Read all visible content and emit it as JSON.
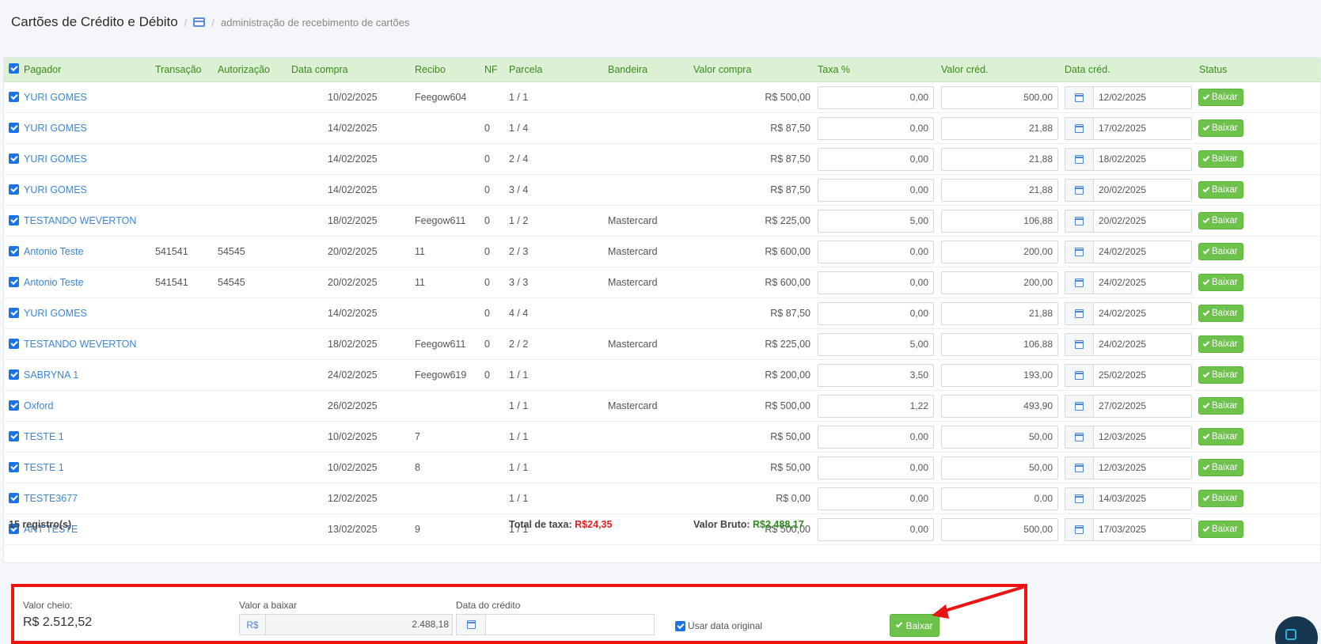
{
  "header": {
    "title": "Cartões de Crédito e Débito",
    "crumb": "administração de recebimento de cartões"
  },
  "table": {
    "columns": {
      "pagador": "Pagador",
      "transacao": "Transação",
      "autorizacao": "Autorização",
      "data_compra": "Data compra",
      "recibo": "Recibo",
      "nf": "NF",
      "parcela": "Parcela",
      "bandeira": "Bandeira",
      "valor_compra": "Valor compra",
      "taxa": "Taxa %",
      "valor_cred": "Valor créd.",
      "data_cred": "Data créd.",
      "status": "Status"
    },
    "rows": [
      {
        "pagador": "YURI GOMES",
        "transacao": "",
        "autorizacao": "",
        "data_compra": "10/02/2025",
        "recibo": "Feegow604",
        "nf": "",
        "parcela": "1 / 1",
        "bandeira": "",
        "valor_compra": "R$ 500,00",
        "taxa": "0,00",
        "valor_cred": "500,00",
        "data_cred": "12/02/2025",
        "status": "Baixar"
      },
      {
        "pagador": "YURI GOMES",
        "transacao": "",
        "autorizacao": "",
        "data_compra": "14/02/2025",
        "recibo": "",
        "nf": "0",
        "parcela": "1 / 4",
        "bandeira": "",
        "valor_compra": "R$ 87,50",
        "taxa": "0,00",
        "valor_cred": "21,88",
        "data_cred": "17/02/2025",
        "status": "Baixar"
      },
      {
        "pagador": "YURI GOMES",
        "transacao": "",
        "autorizacao": "",
        "data_compra": "14/02/2025",
        "recibo": "",
        "nf": "0",
        "parcela": "2 / 4",
        "bandeira": "",
        "valor_compra": "R$ 87,50",
        "taxa": "0,00",
        "valor_cred": "21,88",
        "data_cred": "18/02/2025",
        "status": "Baixar"
      },
      {
        "pagador": "YURI GOMES",
        "transacao": "",
        "autorizacao": "",
        "data_compra": "14/02/2025",
        "recibo": "",
        "nf": "0",
        "parcela": "3 / 4",
        "bandeira": "",
        "valor_compra": "R$ 87,50",
        "taxa": "0,00",
        "valor_cred": "21,88",
        "data_cred": "20/02/2025",
        "status": "Baixar"
      },
      {
        "pagador": "TESTANDO WEVERTON",
        "transacao": "",
        "autorizacao": "",
        "data_compra": "18/02/2025",
        "recibo": "Feegow611",
        "nf": "0",
        "parcela": "1 / 2",
        "bandeira": "Mastercard",
        "valor_compra": "R$ 225,00",
        "taxa": "5,00",
        "valor_cred": "106,88",
        "data_cred": "20/02/2025",
        "status": "Baixar"
      },
      {
        "pagador": "Antonio Teste",
        "transacao": "541541",
        "autorizacao": "54545",
        "data_compra": "20/02/2025",
        "recibo": "11",
        "nf": "0",
        "parcela": "2 / 3",
        "bandeira": "Mastercard",
        "valor_compra": "R$ 600,00",
        "taxa": "0,00",
        "valor_cred": "200,00",
        "data_cred": "24/02/2025",
        "status": "Baixar"
      },
      {
        "pagador": "Antonio Teste",
        "transacao": "541541",
        "autorizacao": "54545",
        "data_compra": "20/02/2025",
        "recibo": "11",
        "nf": "0",
        "parcela": "3 / 3",
        "bandeira": "Mastercard",
        "valor_compra": "R$ 600,00",
        "taxa": "0,00",
        "valor_cred": "200,00",
        "data_cred": "24/02/2025",
        "status": "Baixar"
      },
      {
        "pagador": "YURI GOMES",
        "transacao": "",
        "autorizacao": "",
        "data_compra": "14/02/2025",
        "recibo": "",
        "nf": "0",
        "parcela": "4 / 4",
        "bandeira": "",
        "valor_compra": "R$ 87,50",
        "taxa": "0,00",
        "valor_cred": "21,88",
        "data_cred": "24/02/2025",
        "status": "Baixar"
      },
      {
        "pagador": "TESTANDO WEVERTON",
        "transacao": "",
        "autorizacao": "",
        "data_compra": "18/02/2025",
        "recibo": "Feegow611",
        "nf": "0",
        "parcela": "2 / 2",
        "bandeira": "Mastercard",
        "valor_compra": "R$ 225,00",
        "taxa": "5,00",
        "valor_cred": "106,88",
        "data_cred": "24/02/2025",
        "status": "Baixar"
      },
      {
        "pagador": "SABRYNA 1",
        "transacao": "",
        "autorizacao": "",
        "data_compra": "24/02/2025",
        "recibo": "Feegow619",
        "nf": "0",
        "parcela": "1 / 1",
        "bandeira": "",
        "valor_compra": "R$ 200,00",
        "taxa": "3,50",
        "valor_cred": "193,00",
        "data_cred": "25/02/2025",
        "status": "Baixar"
      },
      {
        "pagador": "Oxford",
        "transacao": "",
        "autorizacao": "",
        "data_compra": "26/02/2025",
        "recibo": "",
        "nf": "",
        "parcela": "1 / 1",
        "bandeira": "Mastercard",
        "valor_compra": "R$ 500,00",
        "taxa": "1,22",
        "valor_cred": "493,90",
        "data_cred": "27/02/2025",
        "status": "Baixar"
      },
      {
        "pagador": "TESTE 1",
        "transacao": "",
        "autorizacao": "",
        "data_compra": "10/02/2025",
        "recibo": "7",
        "nf": "",
        "parcela": "1 / 1",
        "bandeira": "",
        "valor_compra": "R$ 50,00",
        "taxa": "0,00",
        "valor_cred": "50,00",
        "data_cred": "12/03/2025",
        "status": "Baixar"
      },
      {
        "pagador": "TESTE 1",
        "transacao": "",
        "autorizacao": "",
        "data_compra": "10/02/2025",
        "recibo": "8",
        "nf": "",
        "parcela": "1 / 1",
        "bandeira": "",
        "valor_compra": "R$ 50,00",
        "taxa": "0,00",
        "valor_cred": "50,00",
        "data_cred": "12/03/2025",
        "status": "Baixar"
      },
      {
        "pagador": "TESTE3677",
        "transacao": "",
        "autorizacao": "",
        "data_compra": "12/02/2025",
        "recibo": "",
        "nf": "",
        "parcela": "1 / 1",
        "bandeira": "",
        "valor_compra": "R$ 0,00",
        "taxa": "0,00",
        "valor_cred": "0,00",
        "data_cred": "14/03/2025",
        "status": "Baixar"
      },
      {
        "pagador": "ANT TESTE",
        "transacao": "",
        "autorizacao": "",
        "data_compra": "13/02/2025",
        "recibo": "9",
        "nf": "",
        "parcela": "1 / 1",
        "bandeira": "",
        "valor_compra": "R$ 500,00",
        "taxa": "0,00",
        "valor_cred": "500,00",
        "data_cred": "17/03/2025",
        "status": "Baixar"
      }
    ],
    "footer": {
      "count": "15 registro(s)",
      "total_taxa_label": "Total de taxa:",
      "total_taxa_value": "R$24,35",
      "valor_bruto_label": "Valor Bruto:",
      "valor_bruto_value": "R$2.488,17"
    }
  },
  "summary": {
    "valor_cheio_label": "Valor cheio:",
    "valor_cheio_value": "R$ 2.512,52",
    "valor_baixar_label": "Valor a baixar",
    "currency_addon": "R$",
    "valor_baixar_value": "2.488,18",
    "data_credito_label": "Data do crédito",
    "data_credito_value": "",
    "usar_data_label": "Usar data original",
    "baixar_button": "Baixar"
  },
  "colors": {
    "header_green": "#dcf1d4",
    "link_blue": "#3e86d1",
    "button_green": "#6cc24a",
    "highlight_red": "#ec1313"
  }
}
